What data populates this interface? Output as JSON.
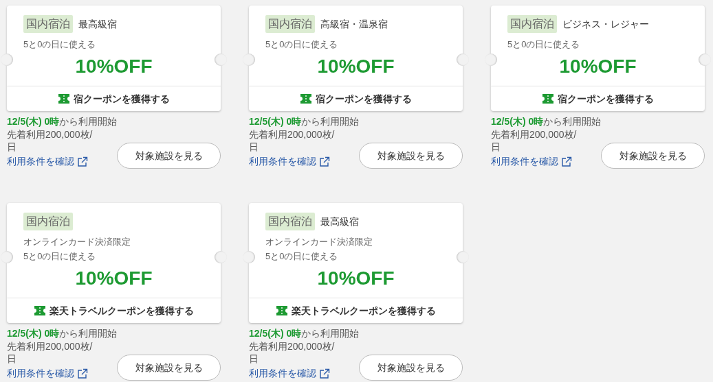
{
  "coupons": [
    {
      "tag": "国内宿泊",
      "category": "最高級宿",
      "notes": [
        "5と0の日に使える"
      ],
      "discount": "10%OFF",
      "get_label": "宿クーポンを獲得する",
      "start_date": "12/5(木) 0時",
      "start_suffix": "から利用開始",
      "limit": "先着利用200,000枚/日",
      "terms_link": "利用条件を確認",
      "view_button": "対象施設を見る"
    },
    {
      "tag": "国内宿泊",
      "category": "高級宿・温泉宿",
      "notes": [
        "5と0の日に使える"
      ],
      "discount": "10%OFF",
      "get_label": "宿クーポンを獲得する",
      "start_date": "12/5(木) 0時",
      "start_suffix": "から利用開始",
      "limit": "先着利用200,000枚/日",
      "terms_link": "利用条件を確認",
      "view_button": "対象施設を見る"
    },
    {
      "tag": "国内宿泊",
      "category": "ビジネス・レジャー",
      "notes": [
        "5と0の日に使える"
      ],
      "discount": "10%OFF",
      "get_label": "宿クーポンを獲得する",
      "start_date": "12/5(木) 0時",
      "start_suffix": "から利用開始",
      "limit": "先着利用200,000枚/日",
      "terms_link": "利用条件を確認",
      "view_button": "対象施設を見る"
    },
    {
      "tag": "国内宿泊",
      "notes": [
        "オンラインカード決済限定",
        "5と0の日に使える"
      ],
      "discount": "10%OFF",
      "get_label": "楽天トラベルクーポンを獲得する",
      "start_date": "12/5(木) 0時",
      "start_suffix": "から利用開始",
      "limit": "先着利用200,000枚/日",
      "terms_link": "利用条件を確認",
      "view_button": "対象施設を見る"
    },
    {
      "tag": "国内宿泊",
      "category": "最高級宿",
      "notes": [
        "オンラインカード決済限定",
        "5と0の日に使える"
      ],
      "discount": "10%OFF",
      "get_label": "楽天トラベルクーポンを獲得する",
      "start_date": "12/5(木) 0時",
      "start_suffix": "から利用開始",
      "limit": "先着利用200,000枚/日",
      "terms_link": "利用条件を確認",
      "view_button": "対象施設を見る"
    }
  ]
}
